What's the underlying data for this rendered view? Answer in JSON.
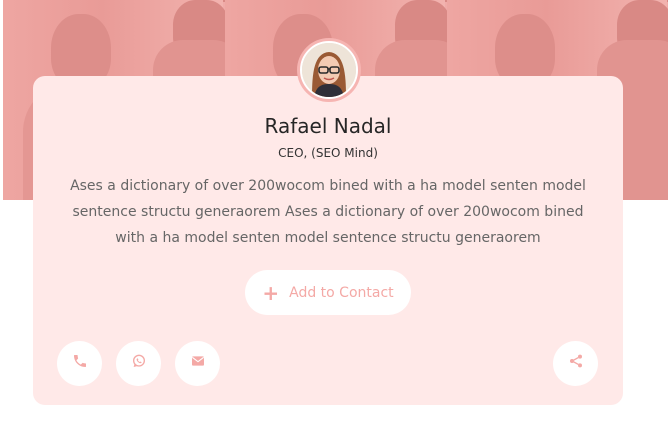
{
  "profile": {
    "name": "Rafael Nadal",
    "role": "CEO, (SEO Mind)",
    "bio": "Ases a dictionary of over 200wocom bined with a ha model senten model sentence structu generaorem Ases a dictionary of over 200wocom bined with a ha model senten model sentence structu generaorem"
  },
  "actions": {
    "add_contact_label": "Add to Contact"
  },
  "icons": {
    "add": "plus-icon",
    "phone": "phone-icon",
    "whatsapp": "whatsapp-icon",
    "email": "envelope-icon",
    "share": "share-icon"
  },
  "colors": {
    "accent": "#f4a9a6",
    "card_background": "#ffe9e8",
    "cover_tint": "#f0aba8"
  }
}
